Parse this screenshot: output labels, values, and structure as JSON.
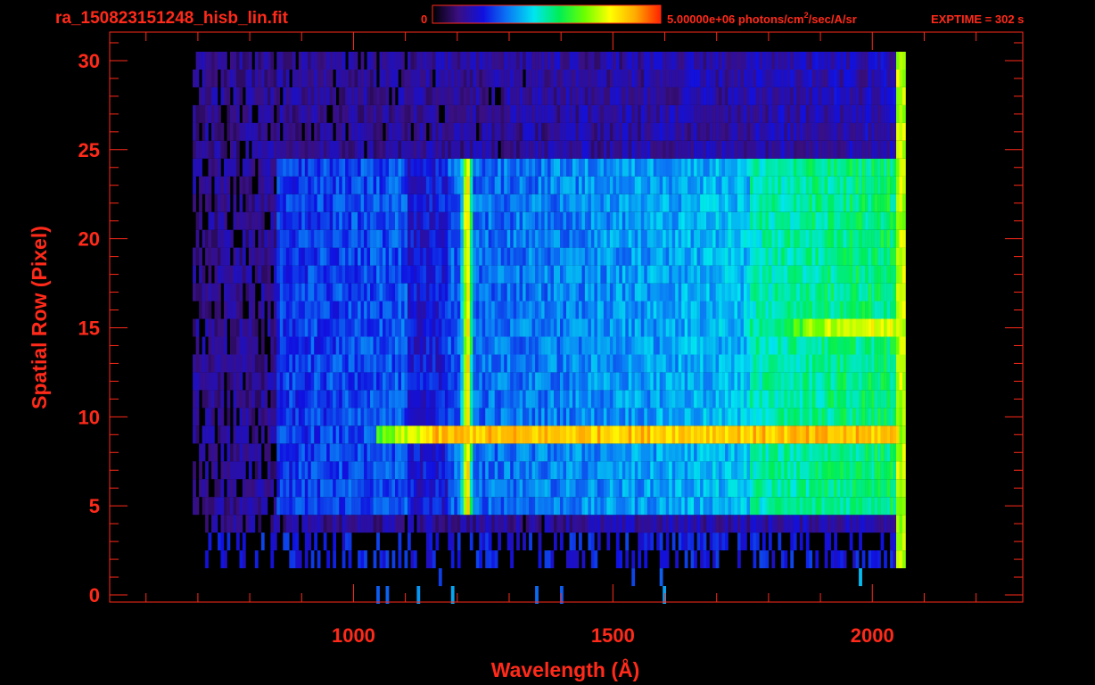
{
  "header": {
    "filename": "ra_150823151248_hisb_lin.fit",
    "colorbar_min": "0",
    "colorbar_max_label": "5.00000e+06 photons/cm",
    "colorbar_max_sup": "2",
    "colorbar_max_tail": "/sec/A/sr",
    "exptime": "EXPTIME = 302 s"
  },
  "colors": {
    "axis": "#ff2a1a",
    "background": "#000000",
    "colormap": [
      "#000000",
      "#3a0f80",
      "#1010e0",
      "#0a7cf5",
      "#00e5f0",
      "#00ee55",
      "#6cff00",
      "#ffff00",
      "#ffaa00",
      "#ff2200"
    ]
  },
  "chart_data": {
    "type": "heatmap",
    "title": "ra_150823151248_hisb_lin.fit",
    "xlabel": "Wavelength (Å)",
    "ylabel": "Spatial Row (Pixel)",
    "xlim": [
      530,
      2290
    ],
    "ylim": [
      -0.4,
      31.6
    ],
    "xticks": [
      1000,
      1500,
      2000
    ],
    "xtick_labels": [
      "1000",
      "1500",
      "2000"
    ],
    "yticks": [
      0,
      5,
      10,
      15,
      20,
      25,
      30
    ],
    "ytick_labels": [
      "0",
      "5",
      "10",
      "15",
      "20",
      "25",
      "30"
    ],
    "colorbar_range": [
      0,
      5000000
    ],
    "colorbar_unit": "photons/cm2/sec/A/sr",
    "data_extent_x": [
      690,
      2060
    ],
    "data_extent_y": [
      2,
      30
    ],
    "features": [
      {
        "kind": "emission_line",
        "wavelength": 1216,
        "rows": [
          5,
          24
        ],
        "relative_intensity": 0.88
      },
      {
        "kind": "row_band",
        "row": 9,
        "wavelength_range": [
          1040,
          2050
        ],
        "relative_intensity": 0.85
      },
      {
        "kind": "row_band",
        "row": 15,
        "wavelength_range": [
          1800,
          2050
        ],
        "relative_intensity": 0.75
      },
      {
        "kind": "extended_emission",
        "rows": [
          5,
          24
        ],
        "wavelength_range": [
          850,
          2050
        ],
        "relative_intensity": 0.45
      }
    ],
    "grid": false,
    "legend": "colorbar at top"
  }
}
